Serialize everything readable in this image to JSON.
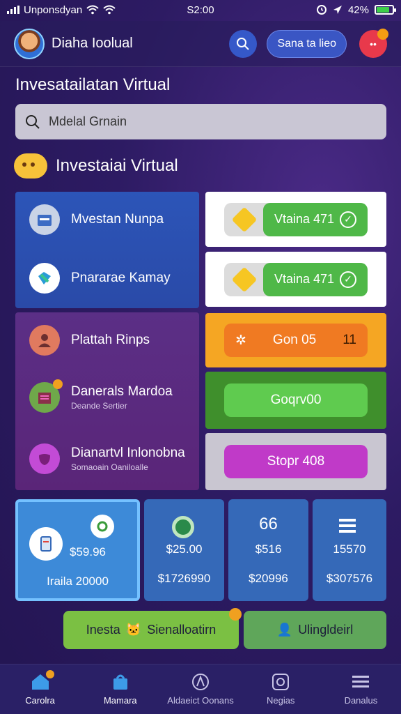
{
  "status_bar": {
    "carrier": "Unponsdyan",
    "time": "S2:00",
    "battery": "42%"
  },
  "header": {
    "brand": "Diaha Ioolual",
    "pill_label": "Sana ta lieo",
    "notif_label": "••"
  },
  "page_title": "Invesatailatan Virtual",
  "search": {
    "value": "Mdelal Grnain"
  },
  "section_title": "Investaiai Virtual",
  "blue_panel": [
    {
      "label": "Mvestan Nunpa"
    },
    {
      "label": "Pnararae Kamay"
    }
  ],
  "purple_panel": [
    {
      "label": "Plattah Rinps",
      "sub": ""
    },
    {
      "label": "Danerals Mardoa",
      "sub": "Deande Sertier"
    },
    {
      "label": "Dianartvl Inlonobna",
      "sub": "Somaoain Oaniloalle"
    }
  ],
  "cards": [
    {
      "label": "Vtaina 471"
    },
    {
      "label": "Vtaina 471"
    },
    {
      "label": "Gon 05",
      "suffix": "11"
    },
    {
      "label": "Goqrv00"
    },
    {
      "label": "Stopr 408"
    }
  ],
  "stats": [
    {
      "top": "",
      "mid": "$59.96",
      "bot": "Iraila 20000"
    },
    {
      "top": "",
      "mid": "$25.00",
      "bot": "$1726990"
    },
    {
      "top": "66",
      "mid": "$516",
      "bot": "$20996"
    },
    {
      "top": "",
      "mid": "15570",
      "bot": "$307576"
    }
  ],
  "banners": [
    {
      "label": "Inesta",
      "label2": "Sienalloatirn"
    },
    {
      "label": "Ulingldeirl"
    }
  ],
  "tabs": [
    {
      "label": "Carolra",
      "icon": "home-icon"
    },
    {
      "label": "Mamara",
      "icon": "bag-icon"
    },
    {
      "label": "Aldaeict Oonans",
      "icon": "compass-icon"
    },
    {
      "label": "Negias",
      "icon": "camera-icon"
    },
    {
      "label": "Danalus",
      "icon": "menu-icon"
    }
  ],
  "colors": {
    "accent_green": "#4fb848",
    "accent_orange": "#f5a623",
    "accent_blue": "#3569b8",
    "bg": "#2d1b63"
  }
}
